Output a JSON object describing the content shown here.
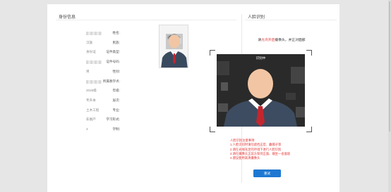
{
  "left_panel": {
    "title": "身份信息",
    "rows": [
      {
        "label": "姓名:",
        "value": "",
        "masked": true
      },
      {
        "label": "民族:",
        "value": "汉族",
        "masked": false
      },
      {
        "label": "证件类型:",
        "value": "身份证",
        "masked": false
      },
      {
        "label": "证件号码:",
        "value": "",
        "masked": true
      },
      {
        "label": "性别:",
        "value": "男",
        "masked": false
      },
      {
        "label": "所属教学点:",
        "value": "",
        "masked": true
      },
      {
        "label": "年级:",
        "value": "2026级",
        "masked": false
      },
      {
        "label": "层次:",
        "value": "专升本",
        "masked": false
      },
      {
        "label": "专业:",
        "value": "土木工程",
        "masked": false
      },
      {
        "label": "学习形式:",
        "value": "非脱产",
        "masked": false
      },
      {
        "label": "学制:",
        "value": "3",
        "masked": false
      }
    ]
  },
  "right_panel": {
    "title": "人脸识别",
    "tip_prefix": "请",
    "tip_highlight": "允许开启",
    "tip_suffix": "摄像头，并正对面部",
    "camera_status": "识别中",
    "notes": [
      "人脸识别注意事项:",
      "1.人脸识别时请勿遮挡五官、戴帽子等",
      "2.请在光线充足的环境下进行人脸识别",
      "3.请在摄像头正前方保持正面、端坐一会面容",
      "4.建议使用高清摄像头"
    ],
    "button_label": "重试"
  },
  "colors": {
    "accent": "#1e78d2",
    "warning": "#e0312f"
  }
}
